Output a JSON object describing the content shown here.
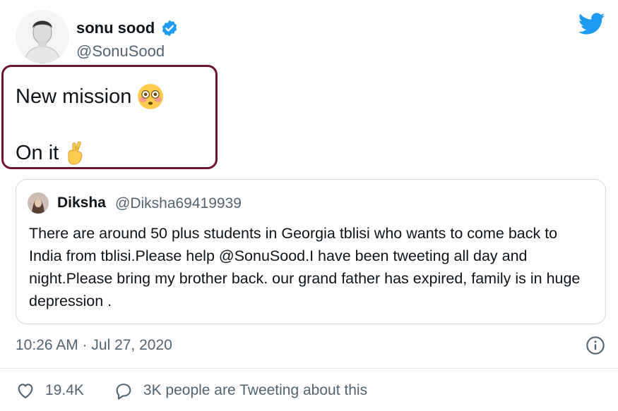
{
  "author": {
    "name": "sonu sood",
    "handle": "@SonuSood",
    "verified": true,
    "verified_color": "#1d9bf0"
  },
  "tweet": {
    "line1": "New mission",
    "line1_emoji": "😳",
    "line2": "On it",
    "line2_emoji": "🤞"
  },
  "highlight_color": "#6b1530",
  "quoted_tweet": {
    "name": "Diksha",
    "handle": "@Diksha69419939",
    "text": "There are around 50 plus students in Georgia tblisi who wants to come back to India from tblisi.Please help @SonuSood.I have been tweeting all day and night.Please bring my brother back. our grand father has expired, family is in huge depression ."
  },
  "meta": {
    "timestamp": "10:26 AM · Jul 27, 2020"
  },
  "actions": {
    "likes": "19.4K",
    "conversation": "3K people are Tweeting about this"
  },
  "icons": {
    "brand": "twitter-bird-icon",
    "info": "info-icon",
    "like": "heart-icon",
    "reply": "speech-bubble-icon"
  },
  "brand_color": "#1d9bf0"
}
